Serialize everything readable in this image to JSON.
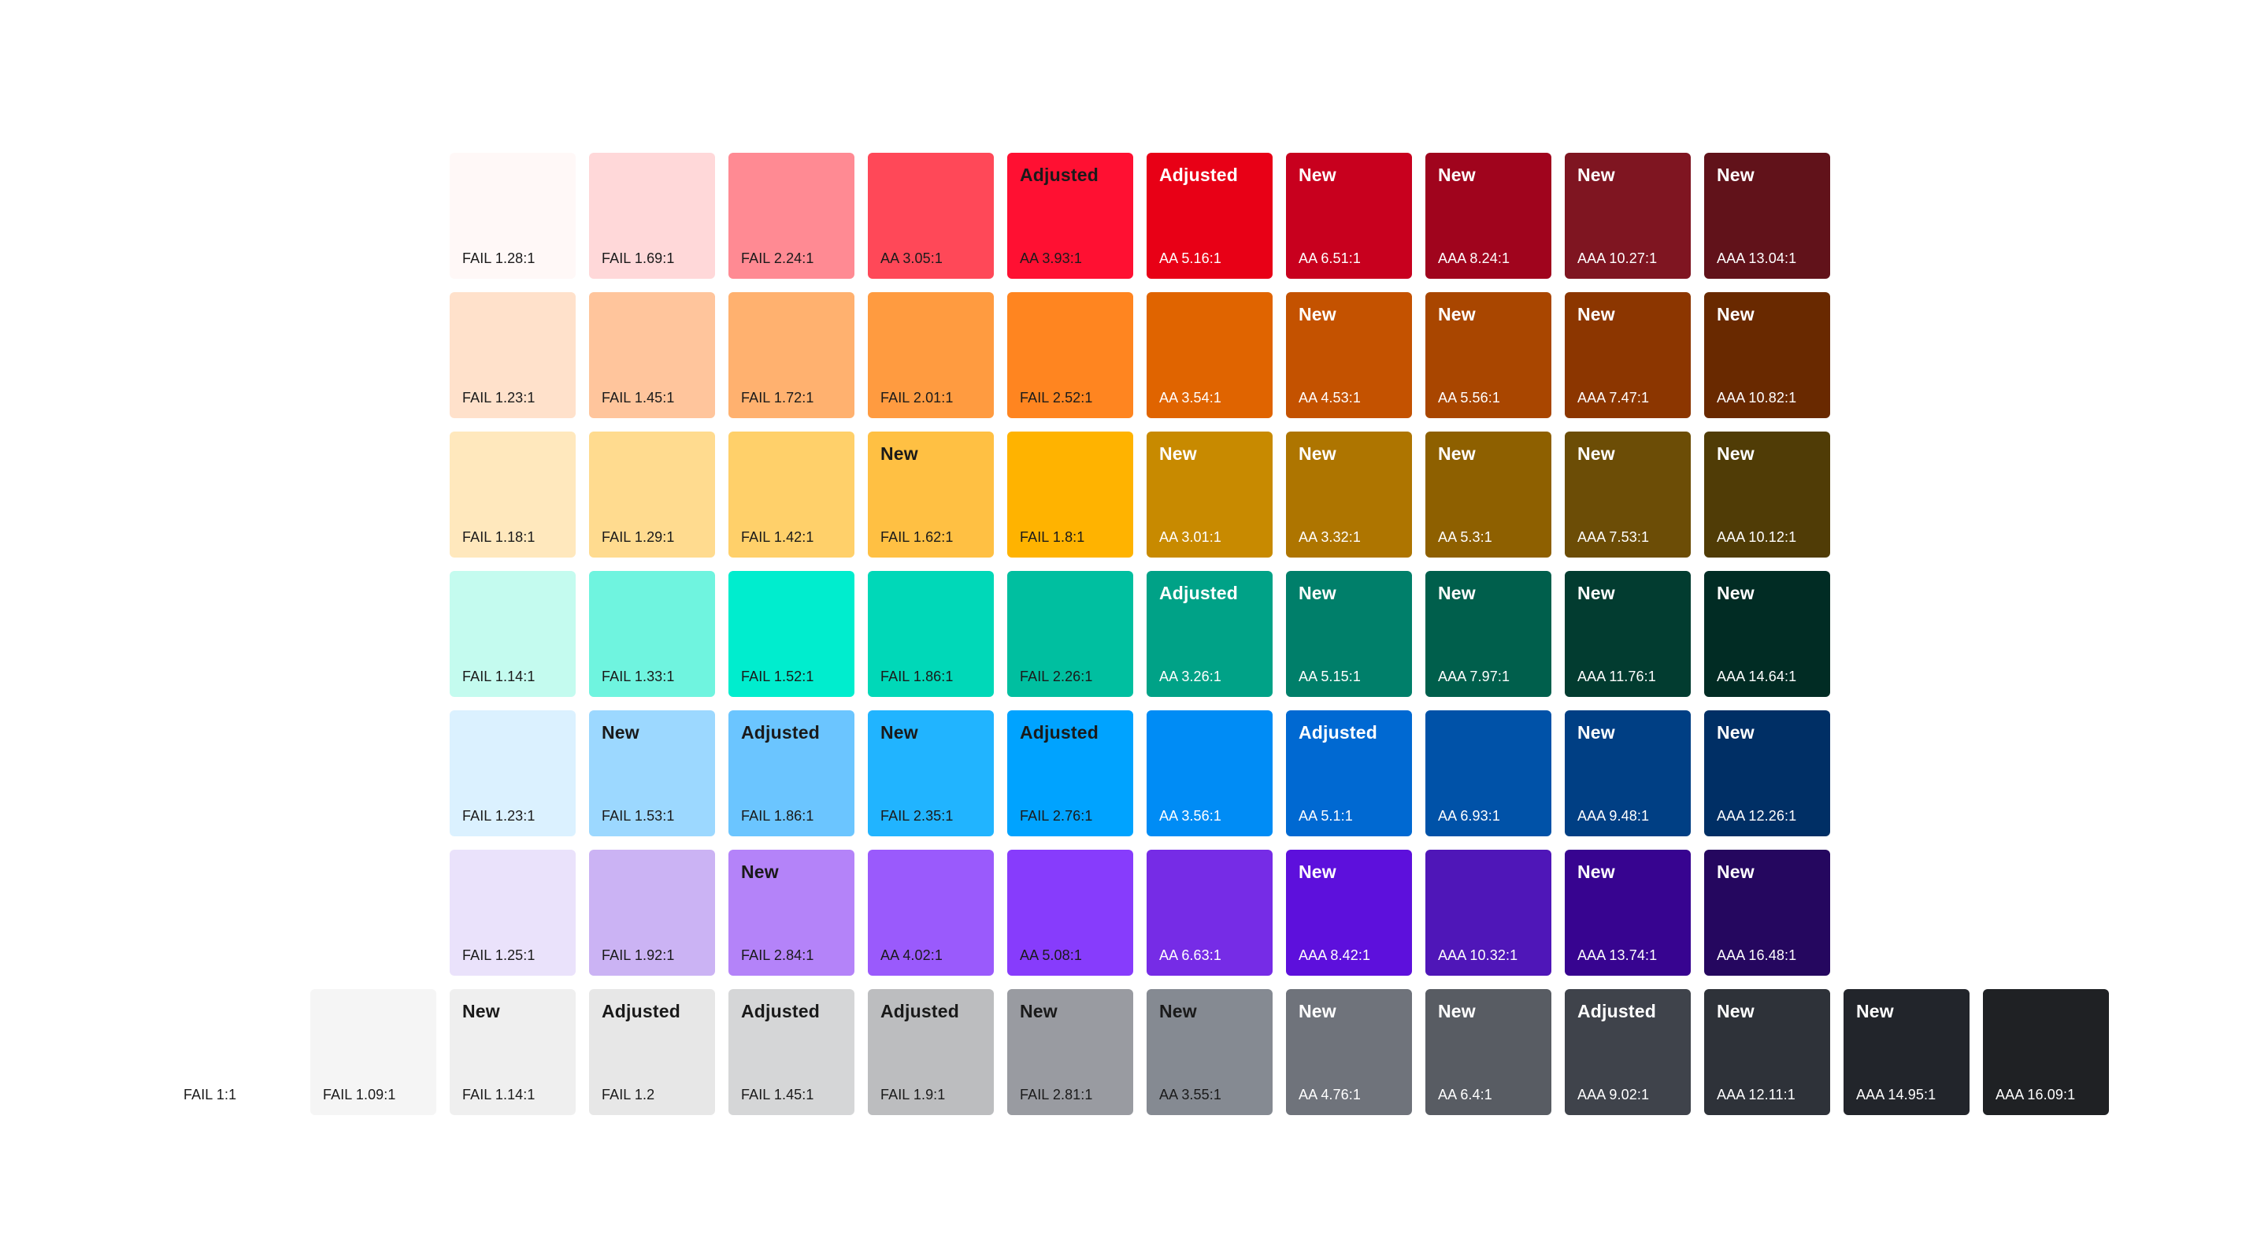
{
  "palette": {
    "rows": [
      {
        "name": "red",
        "swatches": [
          {
            "color": "#FFF8F7",
            "tag": "",
            "contrast": "FAIL 1.28:1",
            "dark": false
          },
          {
            "color": "#FFD8D9",
            "tag": "",
            "contrast": "FAIL 1.69:1",
            "dark": false
          },
          {
            "color": "#FF8A93",
            "tag": "",
            "contrast": "FAIL 2.24:1",
            "dark": false
          },
          {
            "color": "#FF4858",
            "tag": "",
            "contrast": "AA 3.05:1",
            "dark": false
          },
          {
            "color": "#FF1032",
            "tag": "Adjusted",
            "contrast": "AA 3.93:1",
            "dark": false
          },
          {
            "color": "#E80016",
            "tag": "Adjusted",
            "contrast": "AA 5.16:1",
            "dark": true
          },
          {
            "color": "#C8001E",
            "tag": "New",
            "contrast": "AA 6.51:1",
            "dark": true
          },
          {
            "color": "#A0041D",
            "tag": "New",
            "contrast": "AAA 8.24:1",
            "dark": true
          },
          {
            "color": "#7F1521",
            "tag": "New",
            "contrast": "AAA 10.27:1",
            "dark": true
          },
          {
            "color": "#61121A",
            "tag": "New",
            "contrast": "AAA 13.04:1",
            "dark": true
          }
        ]
      },
      {
        "name": "orange",
        "swatches": [
          {
            "color": "#FFE1CB",
            "tag": "",
            "contrast": "FAIL 1.23:1",
            "dark": false
          },
          {
            "color": "#FFC59C",
            "tag": "",
            "contrast": "FAIL 1.45:1",
            "dark": false
          },
          {
            "color": "#FFB16F",
            "tag": "",
            "contrast": "FAIL 1.72:1",
            "dark": false
          },
          {
            "color": "#FF9B40",
            "tag": "",
            "contrast": "FAIL 2.01:1",
            "dark": false
          },
          {
            "color": "#FF8520",
            "tag": "",
            "contrast": "FAIL 2.52:1",
            "dark": false
          },
          {
            "color": "#E06400",
            "tag": "",
            "contrast": "AA 3.54:1",
            "dark": true
          },
          {
            "color": "#C45200",
            "tag": "New",
            "contrast": "AA 4.53:1",
            "dark": true
          },
          {
            "color": "#A94600",
            "tag": "New",
            "contrast": "AA 5.56:1",
            "dark": true
          },
          {
            "color": "#8C3600",
            "tag": "New",
            "contrast": "AAA 7.47:1",
            "dark": true
          },
          {
            "color": "#692900",
            "tag": "New",
            "contrast": "AAA 10.82:1",
            "dark": true
          }
        ]
      },
      {
        "name": "yellow",
        "swatches": [
          {
            "color": "#FFE8BD",
            "tag": "",
            "contrast": "FAIL 1.18:1",
            "dark": false
          },
          {
            "color": "#FFDB8F",
            "tag": "",
            "contrast": "FAIL 1.29:1",
            "dark": false
          },
          {
            "color": "#FFD06A",
            "tag": "",
            "contrast": "FAIL 1.42:1",
            "dark": false
          },
          {
            "color": "#FFC043",
            "tag": "New",
            "contrast": "FAIL 1.62:1",
            "dark": false
          },
          {
            "color": "#FFB300",
            "tag": "",
            "contrast": "FAIL 1.8:1",
            "dark": false
          },
          {
            "color": "#C88A00",
            "tag": "New",
            "contrast": "AA 3.01:1",
            "dark": true
          },
          {
            "color": "#AE7500",
            "tag": "New",
            "contrast": "AA 3.32:1",
            "dark": true
          },
          {
            "color": "#8E6000",
            "tag": "New",
            "contrast": "AA 5.3:1",
            "dark": true
          },
          {
            "color": "#6C4D06",
            "tag": "New",
            "contrast": "AAA 7.53:1",
            "dark": true
          },
          {
            "color": "#503C06",
            "tag": "New",
            "contrast": "AAA 10.12:1",
            "dark": true
          }
        ]
      },
      {
        "name": "teal",
        "swatches": [
          {
            "color": "#C4FBEF",
            "tag": "",
            "contrast": "FAIL 1.14:1",
            "dark": false
          },
          {
            "color": "#6FF4DF",
            "tag": "",
            "contrast": "FAIL 1.33:1",
            "dark": false
          },
          {
            "color": "#00EDCE",
            "tag": "",
            "contrast": "FAIL 1.52:1",
            "dark": false
          },
          {
            "color": "#00D8B8",
            "tag": "",
            "contrast": "FAIL 1.86:1",
            "dark": false
          },
          {
            "color": "#00BFA0",
            "tag": "",
            "contrast": "FAIL 2.26:1",
            "dark": false
          },
          {
            "color": "#00A287",
            "tag": "Adjusted",
            "contrast": "AA 3.26:1",
            "dark": true
          },
          {
            "color": "#007F6A",
            "tag": "New",
            "contrast": "AA 5.15:1",
            "dark": true
          },
          {
            "color": "#005F4C",
            "tag": "New",
            "contrast": "AAA 7.97:1",
            "dark": true
          },
          {
            "color": "#023C30",
            "tag": "New",
            "contrast": "AAA 11.76:1",
            "dark": true
          },
          {
            "color": "#012C24",
            "tag": "New",
            "contrast": "AAA 14.64:1",
            "dark": true
          }
        ]
      },
      {
        "name": "blue",
        "swatches": [
          {
            "color": "#DBF1FF",
            "tag": "",
            "contrast": "FAIL 1.23:1",
            "dark": false
          },
          {
            "color": "#9CD8FF",
            "tag": "New",
            "contrast": "FAIL 1.53:1",
            "dark": false
          },
          {
            "color": "#6BC5FF",
            "tag": "Adjusted",
            "contrast": "FAIL 1.86:1",
            "dark": false
          },
          {
            "color": "#21B4FF",
            "tag": "New",
            "contrast": "FAIL 2.35:1",
            "dark": false
          },
          {
            "color": "#00A3FF",
            "tag": "Adjusted",
            "contrast": "FAIL 2.76:1",
            "dark": false
          },
          {
            "color": "#008CF5",
            "tag": "",
            "contrast": "AA 3.56:1",
            "dark": true
          },
          {
            "color": "#0069D2",
            "tag": "Adjusted",
            "contrast": "AA 5.1:1",
            "dark": true
          },
          {
            "color": "#0052A8",
            "tag": "",
            "contrast": "AA 6.93:1",
            "dark": true
          },
          {
            "color": "#003F84",
            "tag": "New",
            "contrast": "AAA 9.48:1",
            "dark": true
          },
          {
            "color": "#002F65",
            "tag": "New",
            "contrast": "AAA 12.26:1",
            "dark": true
          }
        ]
      },
      {
        "name": "purple",
        "swatches": [
          {
            "color": "#EAE2FB",
            "tag": "",
            "contrast": "FAIL 1.25:1",
            "dark": false
          },
          {
            "color": "#CBB3F4",
            "tag": "",
            "contrast": "FAIL 1.92:1",
            "dark": false
          },
          {
            "color": "#B483F9",
            "tag": "New",
            "contrast": "FAIL 2.84:1",
            "dark": false
          },
          {
            "color": "#9A5AFC",
            "tag": "",
            "contrast": "AA 4.02:1",
            "dark": false
          },
          {
            "color": "#873CFC",
            "tag": "",
            "contrast": "AA 5.08:1",
            "dark": false
          },
          {
            "color": "#762CE6",
            "tag": "",
            "contrast": "AA 6.63:1",
            "dark": true
          },
          {
            "color": "#5D10DC",
            "tag": "New",
            "contrast": "AAA 8.42:1",
            "dark": true
          },
          {
            "color": "#4F16B8",
            "tag": "",
            "contrast": "AAA 10.32:1",
            "dark": true
          },
          {
            "color": "#370490",
            "tag": "New",
            "contrast": "AAA 13.74:1",
            "dark": true
          },
          {
            "color": "#25075F",
            "tag": "New",
            "contrast": "AAA 16.48:1",
            "dark": true
          }
        ]
      },
      {
        "name": "gray",
        "swatches": [
          {
            "color": "#FFFFFF",
            "tag": "",
            "contrast": "FAIL 1:1",
            "dark": false
          },
          {
            "color": "#F5F5F5",
            "tag": "",
            "contrast": "FAIL 1.09:1",
            "dark": false
          },
          {
            "color": "#EFEFEF",
            "tag": "New",
            "contrast": "FAIL 1.14:1",
            "dark": false
          },
          {
            "color": "#E7E7E7",
            "tag": "Adjusted",
            "contrast": "FAIL 1.2",
            "dark": false
          },
          {
            "color": "#D5D6D7",
            "tag": "Adjusted",
            "contrast": "FAIL 1.45:1",
            "dark": false
          },
          {
            "color": "#BCBDBF",
            "tag": "Adjusted",
            "contrast": "FAIL 1.9:1",
            "dark": false
          },
          {
            "color": "#999BA1",
            "tag": "New",
            "contrast": "FAIL 2.81:1",
            "dark": false
          },
          {
            "color": "#858A92",
            "tag": "New",
            "contrast": "AA 3.55:1",
            "dark": false
          },
          {
            "color": "#6F737B",
            "tag": "New",
            "contrast": "AA 4.76:1",
            "dark": true
          },
          {
            "color": "#585C63",
            "tag": "New",
            "contrast": "AA 6.4:1",
            "dark": true
          },
          {
            "color": "#3F434B",
            "tag": "Adjusted",
            "contrast": "AAA 9.02:1",
            "dark": true
          },
          {
            "color": "#2E3239",
            "tag": "New",
            "contrast": "AAA 12.11:1",
            "dark": true
          },
          {
            "color": "#22252B",
            "tag": "New",
            "contrast": "AAA 14.95:1",
            "dark": true
          },
          {
            "color": "#1F2124",
            "tag": "",
            "contrast": "AAA 16.09:1",
            "dark": true
          }
        ]
      }
    ]
  }
}
